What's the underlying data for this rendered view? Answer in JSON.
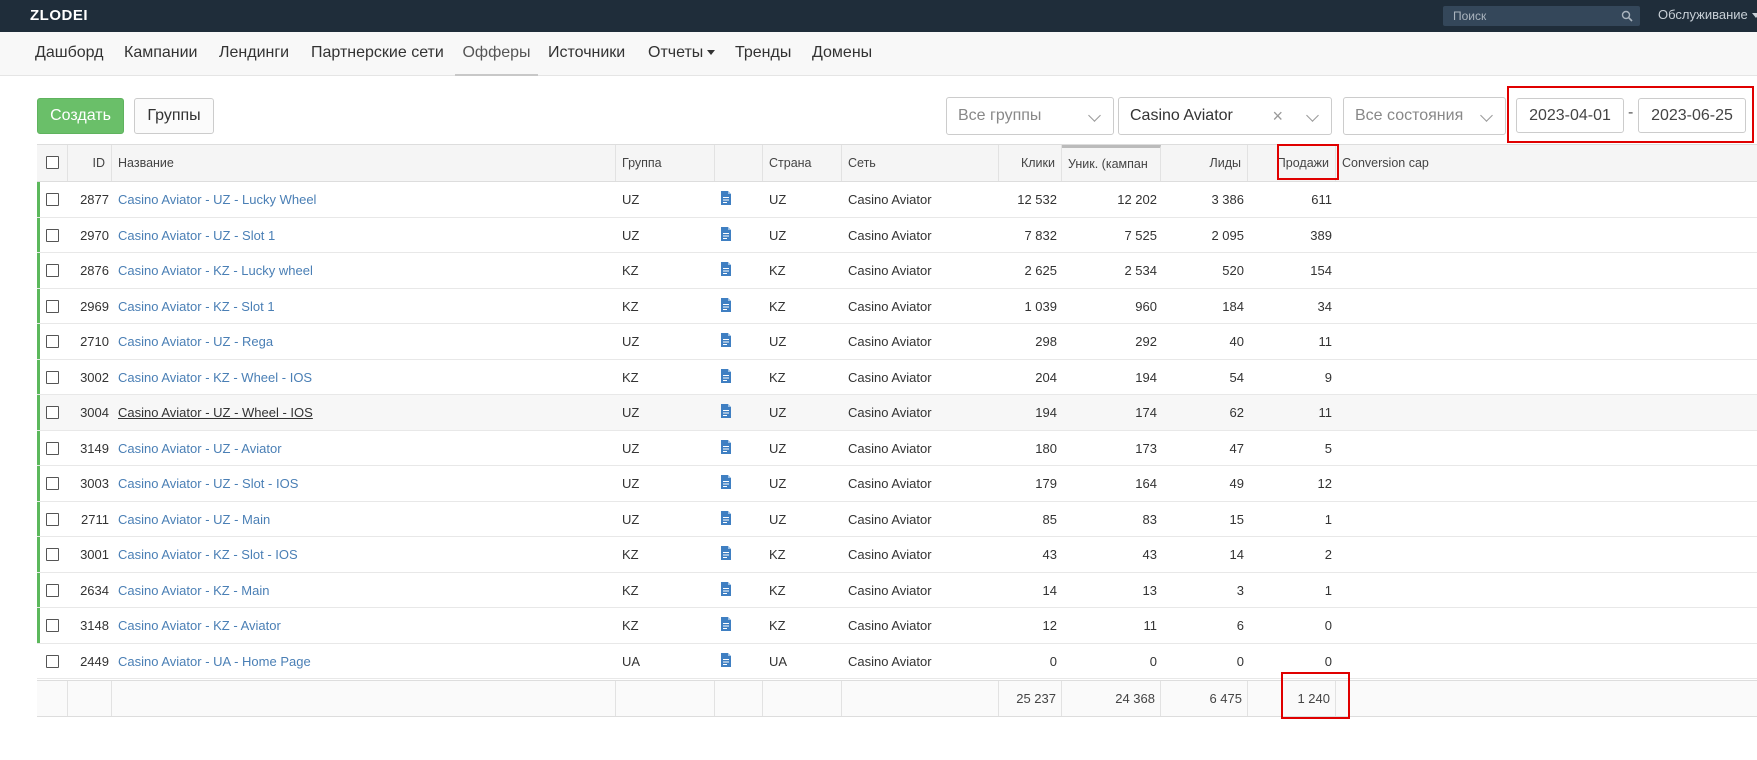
{
  "app": {
    "logo": "ZLODEI"
  },
  "topbar": {
    "search_placeholder": "Поиск",
    "service_label": "Обслуживание"
  },
  "nav": {
    "items": [
      {
        "label": "Дашборд"
      },
      {
        "label": "Кампании"
      },
      {
        "label": "Лендинги"
      },
      {
        "label": "Партнерские сети"
      },
      {
        "label": "Офферы",
        "active": true
      },
      {
        "label": "Источники"
      },
      {
        "label": "Отчеты",
        "dropdown": true
      },
      {
        "label": "Тренды"
      },
      {
        "label": "Домены"
      }
    ]
  },
  "toolbar": {
    "create_label": "Создать",
    "groups_label": "Группы",
    "group_filter": "Все группы",
    "network_filter": "Casino Aviator",
    "state_filter": "Все состояния",
    "date_from": "2023-04-01",
    "date_separator": "-",
    "date_to": "2023-06-25"
  },
  "table": {
    "columns": {
      "id": "ID",
      "name": "Название",
      "group": "Группа",
      "country": "Страна",
      "network": "Сеть",
      "clicks": "Клики",
      "unique": "Уник. (кампан",
      "leads": "Лиды",
      "sales": "Продажи",
      "cap": "Conversion cap"
    },
    "rows": [
      {
        "id": "2877",
        "name": "Casino Aviator - UZ - Lucky Wheel",
        "group": "UZ",
        "country": "UZ",
        "network": "Casino Aviator",
        "clicks": "12 532",
        "unique": "12 202",
        "leads": "3 386",
        "sales": "611",
        "active": true
      },
      {
        "id": "2970",
        "name": "Casino Aviator - UZ - Slot 1",
        "group": "UZ",
        "country": "UZ",
        "network": "Casino Aviator",
        "clicks": "7 832",
        "unique": "7 525",
        "leads": "2 095",
        "sales": "389",
        "active": true
      },
      {
        "id": "2876",
        "name": "Casino Aviator - KZ - Lucky wheel",
        "group": "KZ",
        "country": "KZ",
        "network": "Casino Aviator",
        "clicks": "2 625",
        "unique": "2 534",
        "leads": "520",
        "sales": "154",
        "active": true
      },
      {
        "id": "2969",
        "name": "Casino Aviator - KZ - Slot 1",
        "group": "KZ",
        "country": "KZ",
        "network": "Casino Aviator",
        "clicks": "1 039",
        "unique": "960",
        "leads": "184",
        "sales": "34",
        "active": true
      },
      {
        "id": "2710",
        "name": "Casino Aviator - UZ - Rega",
        "group": "UZ",
        "country": "UZ",
        "network": "Casino Aviator",
        "clicks": "298",
        "unique": "292",
        "leads": "40",
        "sales": "11",
        "active": true
      },
      {
        "id": "3002",
        "name": "Casino Aviator - KZ - Wheel - IOS",
        "group": "KZ",
        "country": "KZ",
        "network": "Casino Aviator",
        "clicks": "204",
        "unique": "194",
        "leads": "54",
        "sales": "9",
        "active": true
      },
      {
        "id": "3004",
        "name": "Casino Aviator - UZ - Wheel - IOS",
        "group": "UZ",
        "country": "UZ",
        "network": "Casino Aviator",
        "clicks": "194",
        "unique": "174",
        "leads": "62",
        "sales": "11",
        "active": true,
        "hover": true
      },
      {
        "id": "3149",
        "name": "Casino Aviator - UZ - Aviator",
        "group": "UZ",
        "country": "UZ",
        "network": "Casino Aviator",
        "clicks": "180",
        "unique": "173",
        "leads": "47",
        "sales": "5",
        "active": true
      },
      {
        "id": "3003",
        "name": "Casino Aviator - UZ - Slot - IOS",
        "group": "UZ",
        "country": "UZ",
        "network": "Casino Aviator",
        "clicks": "179",
        "unique": "164",
        "leads": "49",
        "sales": "12",
        "active": true
      },
      {
        "id": "2711",
        "name": "Casino Aviator - UZ - Main",
        "group": "UZ",
        "country": "UZ",
        "network": "Casino Aviator",
        "clicks": "85",
        "unique": "83",
        "leads": "15",
        "sales": "1",
        "active": true
      },
      {
        "id": "3001",
        "name": "Casino Aviator - KZ - Slot - IOS",
        "group": "KZ",
        "country": "KZ",
        "network": "Casino Aviator",
        "clicks": "43",
        "unique": "43",
        "leads": "14",
        "sales": "2",
        "active": true
      },
      {
        "id": "2634",
        "name": "Casino Aviator - KZ - Main",
        "group": "KZ",
        "country": "KZ",
        "network": "Casino Aviator",
        "clicks": "14",
        "unique": "13",
        "leads": "3",
        "sales": "1",
        "active": true
      },
      {
        "id": "3148",
        "name": "Casino Aviator - KZ - Aviator",
        "group": "KZ",
        "country": "KZ",
        "network": "Casino Aviator",
        "clicks": "12",
        "unique": "11",
        "leads": "6",
        "sales": "0",
        "active": true
      },
      {
        "id": "2449",
        "name": "Casino Aviator - UA - Home Page",
        "group": "UA",
        "country": "UA",
        "network": "Casino Aviator",
        "clicks": "0",
        "unique": "0",
        "leads": "0",
        "sales": "0",
        "active": false
      }
    ],
    "totals": {
      "clicks": "25 237",
      "unique": "24 368",
      "leads": "6 475",
      "sales": "1 240"
    }
  },
  "colors": {
    "topbar": "#1f2d3a",
    "accent_green": "#6abf69",
    "link": "#4a7fb5",
    "highlight": "#e00000"
  }
}
